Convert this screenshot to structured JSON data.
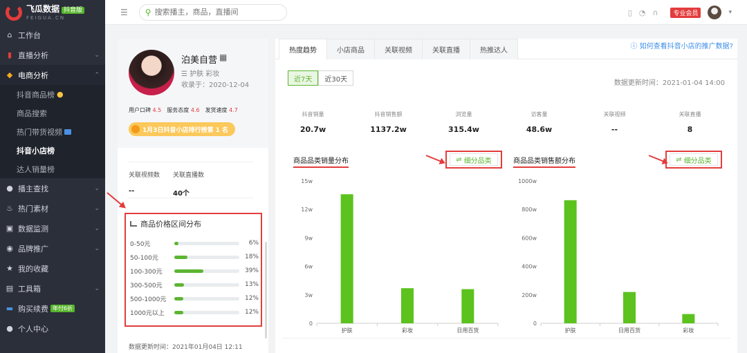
{
  "brand": {
    "name": "飞瓜数据",
    "badge": "抖音版",
    "sub": "FEIGUA.CN"
  },
  "sidebar": {
    "items": [
      {
        "label": "工作台",
        "icon": "home-icon"
      },
      {
        "label": "直播分析",
        "icon": "bar-chart-icon"
      },
      {
        "label": "电商分析",
        "icon": "shop-bag-icon"
      },
      {
        "label": "播主查找",
        "icon": "search-user-icon"
      },
      {
        "label": "热门素材",
        "icon": "fire-icon"
      },
      {
        "label": "数据监测",
        "icon": "monitor-icon"
      },
      {
        "label": "品牌推广",
        "icon": "megaphone-icon"
      },
      {
        "label": "我的收藏",
        "icon": "star-icon"
      },
      {
        "label": "工具箱",
        "icon": "toolbox-icon"
      },
      {
        "label": "购买续费",
        "icon": "card-icon",
        "tag": "年付6折"
      },
      {
        "label": "个人中心",
        "icon": "user-icon"
      }
    ],
    "sub_items": [
      "抖音商品榜",
      "商品搜索",
      "热门带货视频",
      "抖音小店榜",
      "达人销量榜"
    ]
  },
  "topbar": {
    "search_placeholder": "搜索播主，商品，直播间",
    "vip": "专业会员"
  },
  "profile": {
    "shop_name": "泊美自营",
    "categories": "护肤 彩妆",
    "included": "收录于：2020-12-04",
    "metrics": [
      {
        "label": "用户口碑",
        "value": "4.5"
      },
      {
        "label": "服务态度",
        "value": "4.6"
      },
      {
        "label": "发货速度",
        "value": "4.7"
      }
    ],
    "rank": "1月3日抖音小店排行榜第 1 名",
    "related_video_label": "关联视频数",
    "related_live_label": "关联直播数",
    "related_video_value": "--",
    "related_live_value": "40个",
    "price_title": "商品价格区间分布",
    "price_rows": [
      {
        "label": "0-50元",
        "pct": "6%",
        "frac": 0.06
      },
      {
        "label": "50-100元",
        "pct": "18%",
        "frac": 0.18
      },
      {
        "label": "100-300元",
        "pct": "39%",
        "frac": 0.39
      },
      {
        "label": "300-500元",
        "pct": "13%",
        "frac": 0.13
      },
      {
        "label": "500-1000元",
        "pct": "12%",
        "frac": 0.12
      },
      {
        "label": "1000元以上",
        "pct": "12%",
        "frac": 0.12
      }
    ],
    "updated": "数据更新时间：2021年01月04日 12:11"
  },
  "main": {
    "tabs": [
      "热度趋势",
      "小店商品",
      "关联视频",
      "关联直播",
      "热推达人"
    ],
    "help": "如何查看抖音小店的推广数据?",
    "ranges": [
      "近7天",
      "近30天"
    ],
    "data_time": "数据更新时间：2021-01-04 14:00",
    "kpis": [
      {
        "label": "抖音销量",
        "value": "20.7w"
      },
      {
        "label": "抖音销售额",
        "value": "1137.2w"
      },
      {
        "label": "浏览量",
        "value": "315.4w"
      },
      {
        "label": "访客量",
        "value": "48.6w"
      },
      {
        "label": "关联视频",
        "value": "--"
      },
      {
        "label": "关联直播",
        "value": "8"
      }
    ],
    "detail_btn": "细分品类"
  },
  "chart_data": [
    {
      "type": "bar",
      "title": "商品品类销量分布",
      "categories": [
        "护肤",
        "彩妆",
        "日用百货"
      ],
      "values": [
        13.6,
        3.7,
        3.6
      ],
      "ylim": [
        0,
        15
      ],
      "yticks": [
        "0",
        "3w",
        "6w",
        "9w",
        "12w",
        "15w"
      ],
      "color": "#5cc21e"
    },
    {
      "type": "bar",
      "title": "商品品类销售额分布",
      "categories": [
        "护肤",
        "日用百货",
        "彩妆"
      ],
      "values": [
        865,
        220,
        65
      ],
      "ylim": [
        0,
        1000
      ],
      "yticks": [
        "0",
        "200w",
        "400w",
        "600w",
        "800w",
        "1000w"
      ],
      "color": "#5cc21e"
    }
  ]
}
